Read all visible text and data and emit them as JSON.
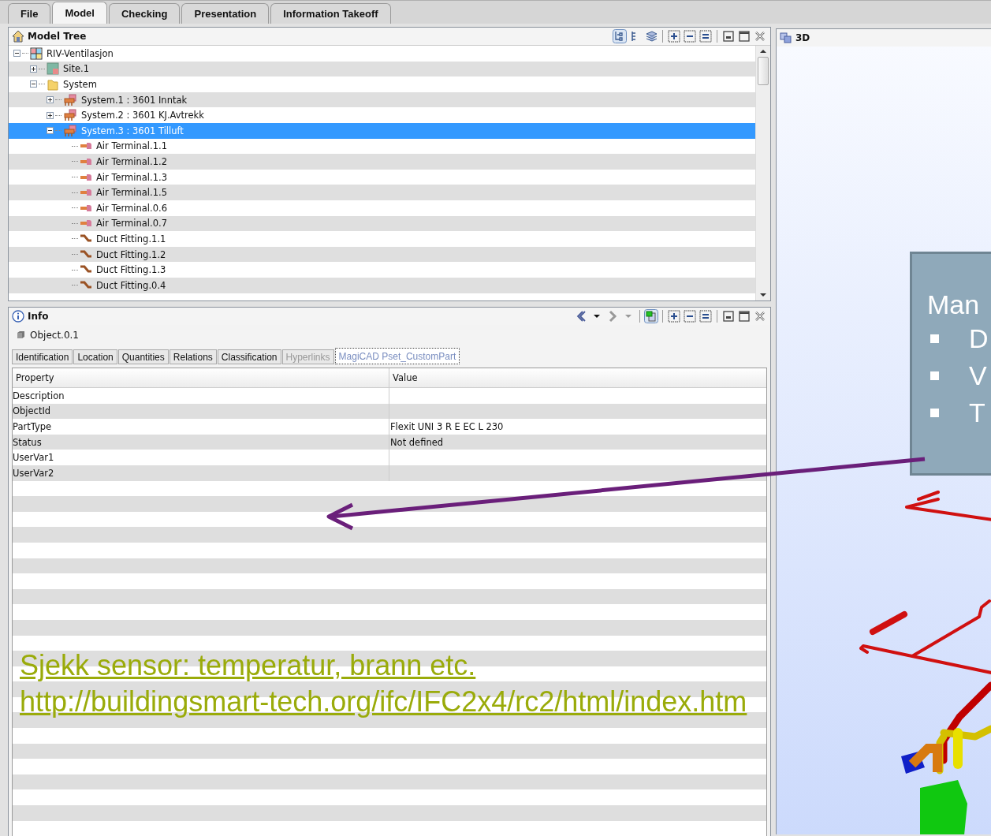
{
  "menu_tabs": [
    {
      "label": "File",
      "selected": false
    },
    {
      "label": "Model",
      "selected": true
    },
    {
      "label": "Checking",
      "selected": false
    },
    {
      "label": "Presentation",
      "selected": false
    },
    {
      "label": "Information Takeoff",
      "selected": false
    }
  ],
  "model_tree": {
    "title": "Model Tree",
    "items": [
      {
        "label": "RIV-Ventilasjon",
        "kind": "model",
        "expanded": true,
        "selected": false,
        "children": [
          {
            "label": "Site.1",
            "kind": "site",
            "expanded": false,
            "selected": false
          },
          {
            "label": "System",
            "kind": "folder",
            "expanded": true,
            "selected": false,
            "children": [
              {
                "label": "System.1 : 3601 Inntak",
                "kind": "system",
                "expanded": false,
                "selected": false
              },
              {
                "label": "System.2 : 3601 KJ.Avtrekk",
                "kind": "system",
                "expanded": false,
                "selected": false
              },
              {
                "label": "System.3 : 3601 Tilluft",
                "kind": "system",
                "expanded": true,
                "selected": true,
                "children": [
                  {
                    "label": "Air Terminal.1.1",
                    "kind": "air-terminal",
                    "selected": false
                  },
                  {
                    "label": "Air Terminal.1.2",
                    "kind": "air-terminal",
                    "selected": false
                  },
                  {
                    "label": "Air Terminal.1.3",
                    "kind": "air-terminal",
                    "selected": false
                  },
                  {
                    "label": "Air Terminal.1.5",
                    "kind": "air-terminal",
                    "selected": false
                  },
                  {
                    "label": "Air Terminal.0.6",
                    "kind": "air-terminal",
                    "selected": false
                  },
                  {
                    "label": "Air Terminal.0.7",
                    "kind": "air-terminal",
                    "selected": false
                  },
                  {
                    "label": "Duct Fitting.1.1",
                    "kind": "duct-fitting",
                    "selected": false
                  },
                  {
                    "label": "Duct Fitting.1.2",
                    "kind": "duct-fitting",
                    "selected": false
                  },
                  {
                    "label": "Duct Fitting.1.3",
                    "kind": "duct-fitting",
                    "selected": false
                  },
                  {
                    "label": "Duct Fitting.0.4",
                    "kind": "duct-fitting",
                    "selected": false
                  }
                ]
              }
            ]
          }
        ]
      }
    ]
  },
  "info": {
    "title": "Info",
    "object": "Object.0.1",
    "tabs": [
      {
        "label": "Identification",
        "selected": false,
        "disabled": false
      },
      {
        "label": "Location",
        "selected": false,
        "disabled": false
      },
      {
        "label": "Quantities",
        "selected": false,
        "disabled": false
      },
      {
        "label": "Relations",
        "selected": false,
        "disabled": false
      },
      {
        "label": "Classification",
        "selected": false,
        "disabled": false
      },
      {
        "label": "Hyperlinks",
        "selected": false,
        "disabled": true
      },
      {
        "label": "MagiCAD Pset_CustomPart",
        "selected": true,
        "disabled": false
      }
    ],
    "table": {
      "columns": [
        "Property",
        "Value"
      ],
      "rows": [
        {
          "property": "Description"
        },
        {
          "property": "ObjectId"
        },
        {
          "property": "PartType",
          "value": "Flexit UNI 3 R E EC L 230"
        },
        {
          "property": "Status",
          "value": "Not defined"
        },
        {
          "property": "UserVar1"
        },
        {
          "property": "UserVar2"
        }
      ]
    }
  },
  "view_3d": {
    "title": "3D",
    "callout": {
      "heading": "Man",
      "bullets": [
        "D",
        "V",
        "T"
      ]
    }
  },
  "annotation": {
    "lines": [
      "Sjekk sensor: temperatur, brann etc.",
      "http://buildingsmart-tech.org/ifc/IFC2x4/rc2/html/index.htm"
    ]
  }
}
